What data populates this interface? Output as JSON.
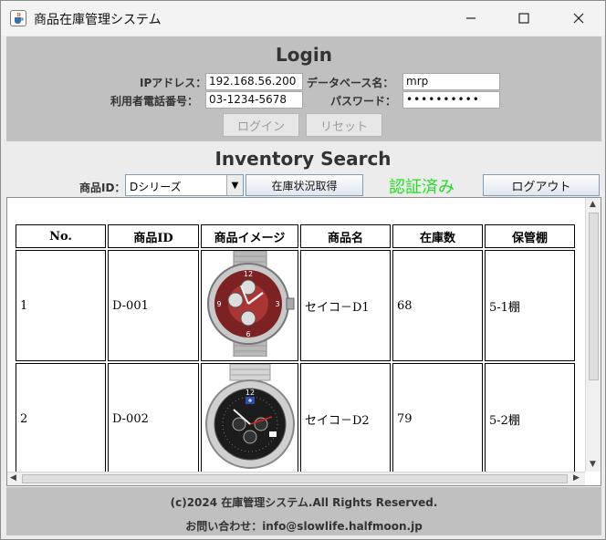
{
  "window": {
    "title": "商品在庫管理システム"
  },
  "login": {
    "heading": "Login",
    "ip_label": "IPアドレス：",
    "ip_value": "192.168.56.200",
    "db_label": "データベース名：",
    "db_value": "mrp",
    "phone_label": "利用者電話番号：",
    "phone_value": "03-1234-5678",
    "password_label": "パスワード：",
    "password_value": "••••••••••",
    "login_button": "ログイン",
    "reset_button": "リセット"
  },
  "search": {
    "heading": "Inventory Search",
    "product_id_label": "商品ID：",
    "product_id_selected": "Dシリーズ",
    "fetch_button": "在庫状況取得",
    "status": "認証済み",
    "logout_button": "ログアウト"
  },
  "table": {
    "headers": [
      "No.",
      "商品ID",
      "商品イメージ",
      "商品名",
      "在庫数",
      "保管棚"
    ],
    "rows": [
      {
        "no": "1",
        "id": "D-001",
        "image": "red-dial-watch",
        "name": "セイコ－D1",
        "stock": "68",
        "shelf": "5-1棚"
      },
      {
        "no": "2",
        "id": "D-002",
        "image": "black-dial-watch",
        "name": "セイコ－D2",
        "stock": "79",
        "shelf": "5-2棚"
      }
    ]
  },
  "footer": {
    "copyright": "(c)2024 在庫管理システム.All Rights Reserved.",
    "contact": "お問い合わせ：info@slowlife.halfmoon.jp"
  },
  "colors": {
    "panel": "#c0c0c0",
    "status": "#22dd22"
  }
}
